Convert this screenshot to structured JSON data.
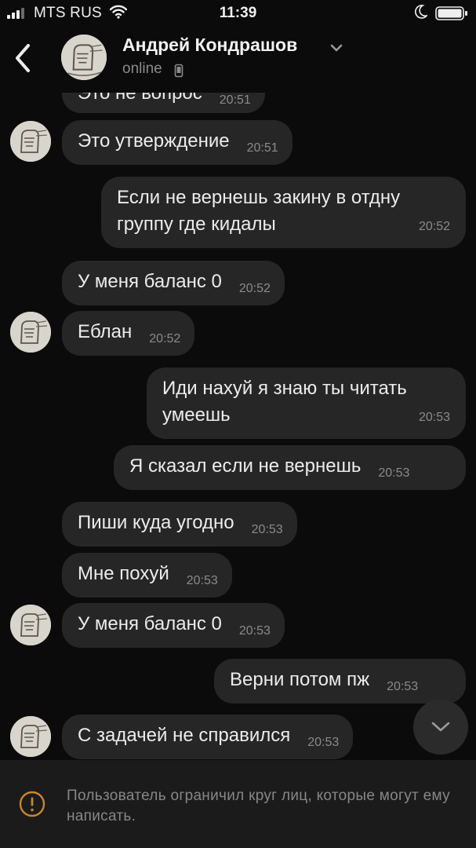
{
  "status_bar": {
    "carrier": "MTS RUS",
    "time": "11:39"
  },
  "header": {
    "contact_name": "Андрей Кондрашов",
    "status": "online"
  },
  "messages": [
    {
      "direction": "incoming",
      "text": "Это не вопрос",
      "time": "20:51"
    },
    {
      "direction": "incoming",
      "text": "Это утверждение",
      "time": "20:51"
    },
    {
      "direction": "outgoing",
      "text": "Если не вернешь закину в отдну группу где кидалы",
      "time": "20:52"
    },
    {
      "direction": "incoming",
      "text": "У меня баланс 0",
      "time": "20:52"
    },
    {
      "direction": "incoming",
      "text": "Еблан",
      "time": "20:52"
    },
    {
      "direction": "outgoing",
      "text": "Иди нахуй я знаю ты читать умеешь",
      "time": "20:53"
    },
    {
      "direction": "outgoing",
      "text": "Я сказал если не вернешь",
      "time": "20:53"
    },
    {
      "direction": "incoming",
      "text": "Пиши куда угодно",
      "time": "20:53"
    },
    {
      "direction": "incoming",
      "text": "Мне похуй",
      "time": "20:53"
    },
    {
      "direction": "incoming",
      "text": "У меня баланс 0",
      "time": "20:53"
    },
    {
      "direction": "outgoing",
      "text": "Верни потом пж",
      "time": "20:53"
    },
    {
      "direction": "incoming",
      "text": "С задачей не справился",
      "time": "20:53"
    }
  ],
  "footer": {
    "restriction_text": "Пользователь ограничил круг лиц, которые могут ему написать."
  },
  "colors": {
    "background": "#0b0b0b",
    "bubble": "#262626",
    "timestamp": "#8a8a8a",
    "footer_background": "#1b1b1b",
    "warning_accent": "#c9852c"
  },
  "icons": {
    "back": "chevron-left-icon",
    "expand": "chevron-down-icon",
    "device": "phone-icon",
    "scroll_down": "chevron-down-icon",
    "restriction": "warning-icon"
  }
}
